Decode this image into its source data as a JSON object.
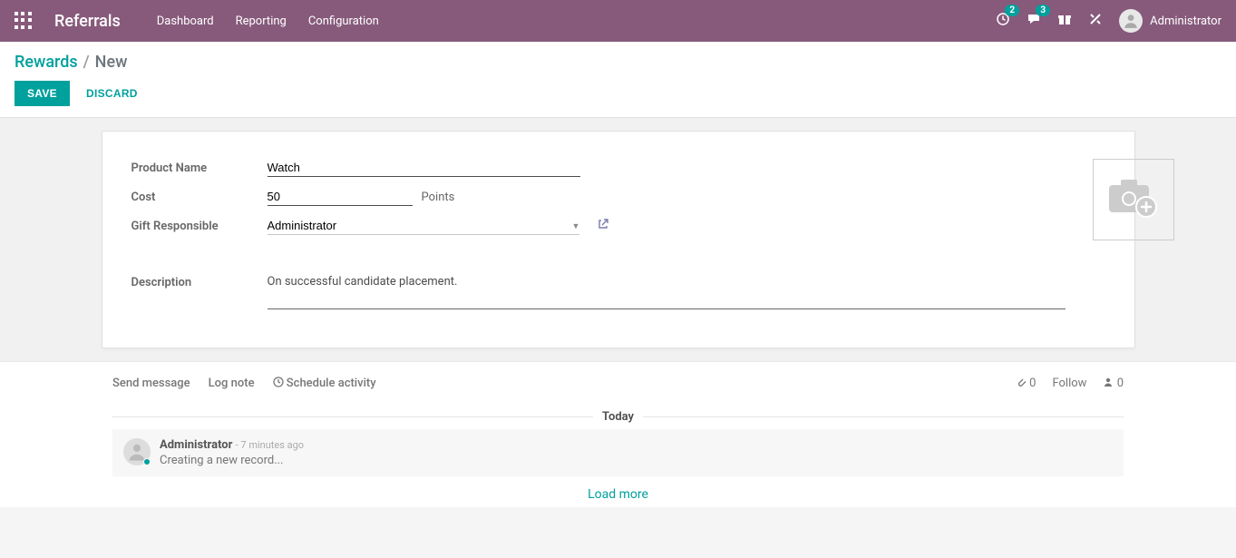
{
  "navbar": {
    "brand": "Referrals",
    "menu": [
      "Dashboard",
      "Reporting",
      "Configuration"
    ],
    "pending_badge": "2",
    "discuss_badge": "3",
    "user_name": "Administrator"
  },
  "breadcrumb": {
    "parent": "Rewards",
    "current": "New"
  },
  "buttons": {
    "save": "SAVE",
    "discard": "DISCARD"
  },
  "form": {
    "labels": {
      "product_name": "Product Name",
      "cost": "Cost",
      "gift_responsible": "Gift Responsible",
      "description": "Description"
    },
    "product_name": "Watch",
    "cost": "50",
    "cost_unit": "Points",
    "gift_responsible": "Administrator",
    "description": "On successful candidate placement."
  },
  "chatter": {
    "send_message": "Send message",
    "log_note": "Log note",
    "schedule_activity": "Schedule activity",
    "attachments": "0",
    "follow": "Follow",
    "followers": "0",
    "today": "Today",
    "log": {
      "author": "Administrator",
      "time": "- 7 minutes ago",
      "body": "Creating a new record..."
    },
    "load_more": "Load more"
  }
}
